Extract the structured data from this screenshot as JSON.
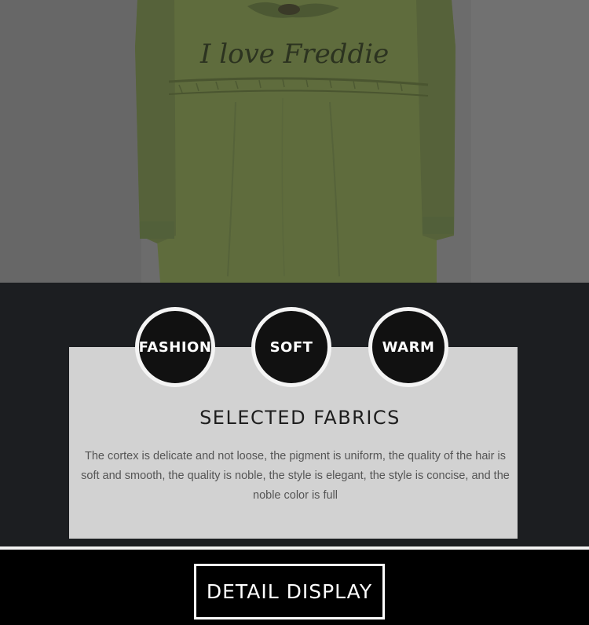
{
  "photo": {
    "embroidery_text": "I love Freddie",
    "coat_color": "#5e6b3c",
    "background_color": "#6f6f6f"
  },
  "badges": [
    {
      "label": "FASHION"
    },
    {
      "label": "SOFT"
    },
    {
      "label": "WARM"
    }
  ],
  "section": {
    "title": "SELECTED FABRICS",
    "description": "The cortex is delicate and not loose, the pigment is uniform, the quality of the hair is soft and smooth, the quality is noble, the style is elegant, the style is concise, and the noble color is full"
  },
  "footer": {
    "button_label": "DETAIL DISPLAY"
  },
  "colors": {
    "band": "#1c1e21",
    "card": "#d2d2d2",
    "badge": "#111111",
    "badge_border": "#f4f4f4"
  }
}
